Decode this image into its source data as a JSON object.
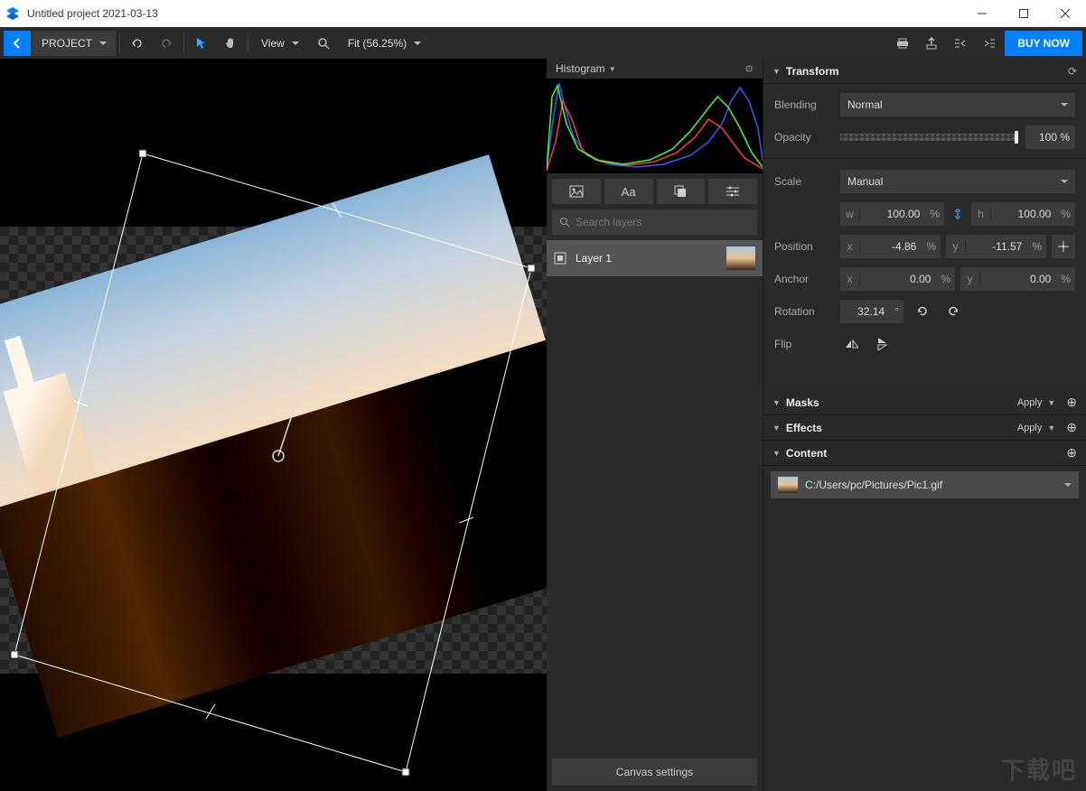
{
  "window": {
    "title": "Untitled project 2021-03-13"
  },
  "toolbar": {
    "project": "PROJECT",
    "view": "View",
    "fit": "Fit (56.25%)",
    "buy": "BUY NOW"
  },
  "histogram": {
    "label": "Histogram"
  },
  "layer_buttons": {
    "image": "image",
    "text": "Aa",
    "mask": "mask",
    "adjust": "adjust"
  },
  "search": {
    "placeholder": "Search layers"
  },
  "layers": [
    {
      "name": "Layer 1"
    }
  ],
  "canvas_settings": "Canvas settings",
  "panels": {
    "transform": "Transform",
    "masks": "Masks",
    "effects": "Effects",
    "content": "Content",
    "apply": "Apply"
  },
  "transform": {
    "blending_label": "Blending",
    "blending_value": "Normal",
    "opacity_label": "Opacity",
    "opacity_value": "100 %",
    "scale_label": "Scale",
    "scale_mode": "Manual",
    "scale_w": "100.00",
    "scale_h": "100.00",
    "position_label": "Position",
    "pos_x": "-4.86",
    "pos_y": "-11.57",
    "anchor_label": "Anchor",
    "anchor_x": "0.00",
    "anchor_y": "0.00",
    "rotation_label": "Rotation",
    "rotation_value": "32.14",
    "rotation_unit": "°",
    "flip_label": "Flip",
    "unit_pct": "%",
    "axis_w": "w",
    "axis_h": "h",
    "axis_x": "x",
    "axis_y": "y"
  },
  "content": {
    "path": "C:/Users/pc/Pictures/Pic1.gif"
  },
  "watermark": "下载吧"
}
